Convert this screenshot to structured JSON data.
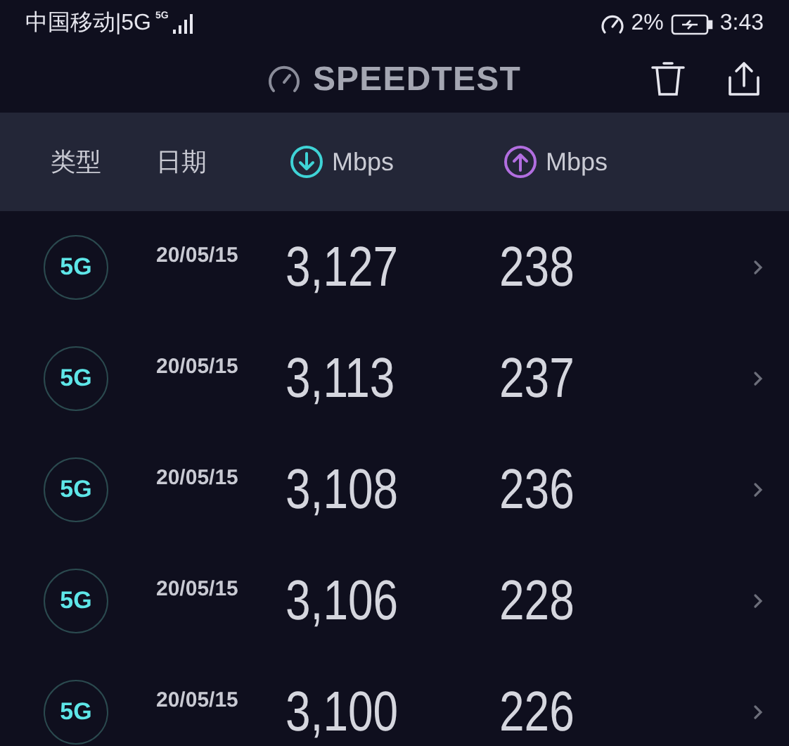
{
  "status_bar": {
    "carrier": "中国移动|5G",
    "network_badge": "5G",
    "data_usage": "2%",
    "time": "3:43"
  },
  "app_bar": {
    "title": "SPEEDTEST"
  },
  "table": {
    "columns": [
      {
        "kind": "text",
        "label": "类型"
      },
      {
        "kind": "text",
        "label": "日期"
      },
      {
        "kind": "download",
        "label": "Mbps"
      },
      {
        "kind": "upload",
        "label": "Mbps"
      }
    ],
    "rows": [
      {
        "type": "5G",
        "date": "20/05/15",
        "download": "3,127",
        "upload": "238"
      },
      {
        "type": "5G",
        "date": "20/05/15",
        "download": "3,113",
        "upload": "237"
      },
      {
        "type": "5G",
        "date": "20/05/15",
        "download": "3,108",
        "upload": "236"
      },
      {
        "type": "5G",
        "date": "20/05/15",
        "download": "3,106",
        "upload": "228"
      },
      {
        "type": "5G",
        "date": "20/05/15",
        "download": "3,100",
        "upload": "226"
      }
    ]
  }
}
